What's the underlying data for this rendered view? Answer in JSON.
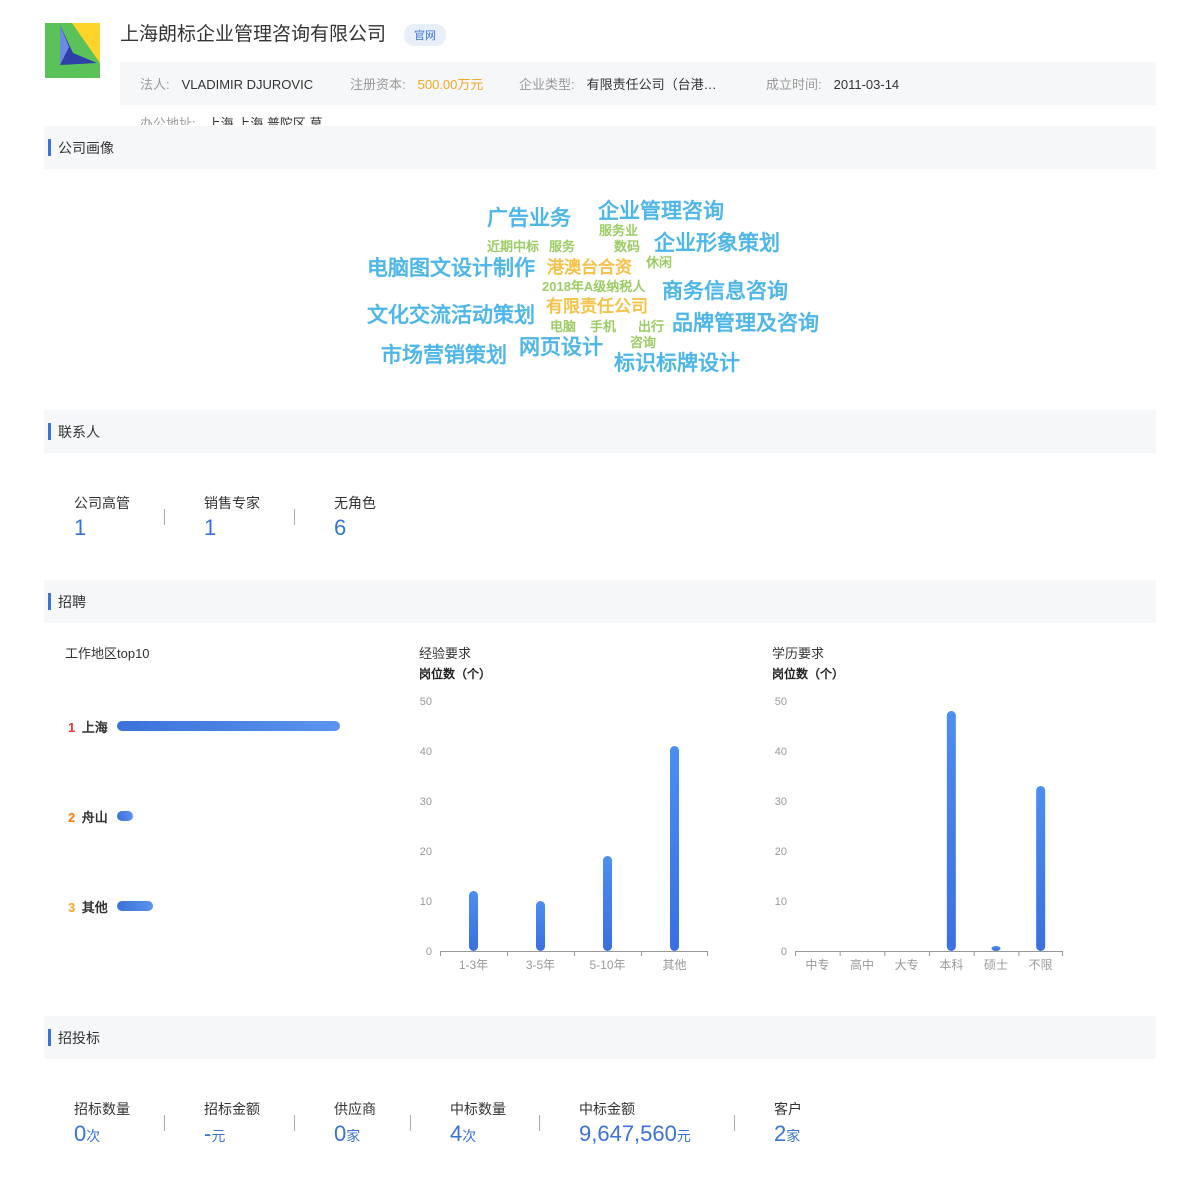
{
  "header": {
    "company_name": "上海朗标企业管理咨询有限公司",
    "site_badge": "官网",
    "legal_person_label": "法人:",
    "legal_person": "VLADIMIR DJUROVIC",
    "capital_label": "注册资本:",
    "capital": "500.00万元",
    "type_label": "企业类型:",
    "type": "有限责任公司（台港…",
    "founded_label": "成立时间:",
    "founded": "2011-03-14",
    "address_label": "办公地址:",
    "address": "上海 上海 普陀区 莫"
  },
  "sections": {
    "portrait": "公司画像",
    "contacts": "联系人",
    "recruit": "招聘",
    "bidding": "招投标"
  },
  "word_cloud": [
    {
      "text": "广告业务",
      "color": "#4fb6e8"
    },
    {
      "text": "企业管理咨询",
      "color": "#4fb6e8"
    },
    {
      "text": "服务业",
      "color": "#9ccc65"
    },
    {
      "text": "近期中标",
      "color": "#9ccc65"
    },
    {
      "text": "服务",
      "color": "#9ccc65"
    },
    {
      "text": "数码",
      "color": "#9ccc65"
    },
    {
      "text": "企业形象策划",
      "color": "#4fb6e8"
    },
    {
      "text": "电脑图文设计制作",
      "color": "#4fb6e8"
    },
    {
      "text": "港澳台合资",
      "color": "#f5c24a"
    },
    {
      "text": "休闲",
      "color": "#9ccc65"
    },
    {
      "text": "2018年A级纳税人",
      "color": "#9ccc65"
    },
    {
      "text": "商务信息咨询",
      "color": "#4fb6e8"
    },
    {
      "text": "文化交流活动策划",
      "color": "#4fb6e8"
    },
    {
      "text": "有限责任公司",
      "color": "#f5c24a"
    },
    {
      "text": "电脑",
      "color": "#9ccc65"
    },
    {
      "text": "手机",
      "color": "#9ccc65"
    },
    {
      "text": "出行",
      "color": "#9ccc65"
    },
    {
      "text": "品牌管理及咨询",
      "color": "#4fb6e8"
    },
    {
      "text": "咨询",
      "color": "#9ccc65"
    },
    {
      "text": "市场营销策划",
      "color": "#4fb6e8"
    },
    {
      "text": "网页设计",
      "color": "#4fb6e8"
    },
    {
      "text": "标识标牌设计",
      "color": "#4fb6e8"
    }
  ],
  "contacts": [
    {
      "label": "公司高管",
      "value": "1"
    },
    {
      "label": "销售专家",
      "value": "1"
    },
    {
      "label": "无角色",
      "value": "6"
    }
  ],
  "recruit": {
    "region_title": "工作地区top10",
    "regions": [
      {
        "rank": "1",
        "name": "上海",
        "rank_color": "#e53935",
        "share": 1.0
      },
      {
        "rank": "2",
        "name": "舟山",
        "rank_color": "#f57c00",
        "share": 0.07
      },
      {
        "rank": "3",
        "name": "其他",
        "rank_color": "#f5a623",
        "share": 0.16
      }
    ]
  },
  "chart_data": [
    {
      "type": "bar",
      "title": "经验要求",
      "ylabel": "岗位数（个）",
      "categories": [
        "1-3年",
        "3-5年",
        "5-10年",
        "其他"
      ],
      "values": [
        12,
        10,
        19,
        41
      ],
      "ylim": [
        0,
        50
      ],
      "yticks": [
        "0",
        "10",
        "20",
        "30",
        "40",
        "50"
      ],
      "grid": false
    },
    {
      "type": "bar",
      "title": "学历要求",
      "ylabel": "岗位数（个）",
      "categories": [
        "中专",
        "高中",
        "大专",
        "本科",
        "硕士",
        "不限"
      ],
      "values": [
        0,
        0,
        0,
        48,
        1,
        33
      ],
      "ylim": [
        0,
        50
      ],
      "yticks": [
        "0",
        "10",
        "20",
        "30",
        "40",
        "50"
      ],
      "grid": false
    }
  ],
  "bidding": [
    {
      "label": "招标数量",
      "value": "0",
      "unit": "次"
    },
    {
      "label": "招标金额",
      "value": "-",
      "unit": "元"
    },
    {
      "label": "供应商",
      "value": "0",
      "unit": "家"
    },
    {
      "label": "中标数量",
      "value": "4",
      "unit": "次"
    },
    {
      "label": "中标金额",
      "value": "9,647,560",
      "unit": "元"
    },
    {
      "label": "客户",
      "value": "2",
      "unit": "家"
    }
  ]
}
